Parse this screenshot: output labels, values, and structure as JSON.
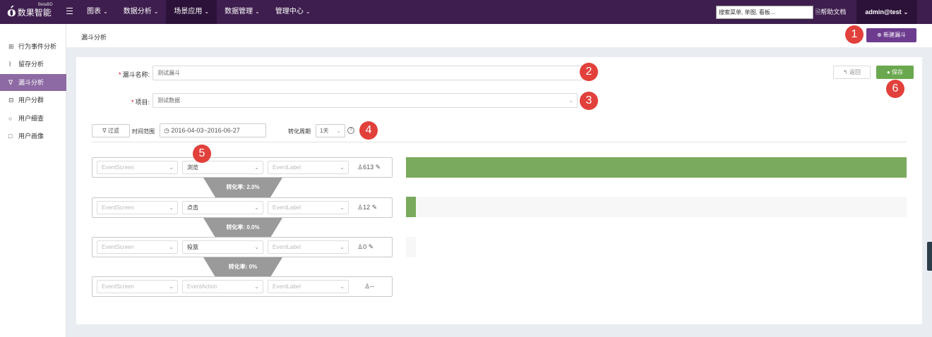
{
  "app": {
    "logo_mark": "ó",
    "logo_text": "数果智能",
    "logo_beta": "BetaBD"
  },
  "nav": {
    "items": [
      {
        "label": "图表"
      },
      {
        "label": "数据分析"
      },
      {
        "label": "场景应用",
        "active": true
      },
      {
        "label": "数据管理"
      },
      {
        "label": "管理中心"
      }
    ],
    "search_placeholder": "搜索菜单, 单图, 看板...",
    "help_label": "帮助文档",
    "user_label": "admin@test"
  },
  "sidebar": {
    "items": [
      {
        "icon": "behavior-icon",
        "glyph": "⊞",
        "label": "行为事件分析"
      },
      {
        "icon": "retention-icon",
        "glyph": "⌇",
        "label": "留存分析"
      },
      {
        "icon": "funnel-icon",
        "glyph": "∇",
        "label": "漏斗分析",
        "active": true
      },
      {
        "icon": "usergroup-icon",
        "glyph": "⊟",
        "label": "用户分群"
      },
      {
        "icon": "search-icon",
        "glyph": "○",
        "label": "用户细查"
      },
      {
        "icon": "profile-icon",
        "glyph": "□",
        "label": "用户画像"
      }
    ]
  },
  "header": {
    "breadcrumb": "漏斗分析",
    "new_button": "新建漏斗"
  },
  "form": {
    "name_label": "漏斗名称:",
    "name_value": "测试漏斗",
    "project_label": "项目:",
    "project_value": "测试数据",
    "back_label": "返回",
    "save_label": "保存"
  },
  "filters": {
    "filter_label": "过滤",
    "time_range_label": "时间范围",
    "date_range": "2016-04-03~2016-06-27",
    "period_label": "转化周期",
    "period_value": "1天"
  },
  "steps": [
    {
      "screen": "EventScreen",
      "action": "浏览",
      "label": "EventLabel",
      "count": "613",
      "bar_fraction": 1.0
    },
    {
      "screen": "EventScreen",
      "action": "点击",
      "label": "EventLabel",
      "count": "12",
      "bar_fraction": 0.02
    },
    {
      "screen": "EventScreen",
      "action": "投篮",
      "label": "EventLabel",
      "count": "0",
      "bar_fraction": 0.0
    },
    {
      "screen": "EventScreen",
      "action": "EventAction",
      "label": "EventLabel",
      "count": "--"
    }
  ],
  "conversions": [
    "转化率: 2.0%",
    "转化率: 0.0%",
    "转化率: 0%"
  ],
  "badges": [
    "1",
    "2",
    "3",
    "4",
    "5",
    "6"
  ],
  "colors": {
    "nav_bg": "#3e1e4e",
    "accent": "#6d3c8f",
    "bar": "#7aaa5d",
    "badge": "#e2403b",
    "save": "#6aa84f"
  }
}
